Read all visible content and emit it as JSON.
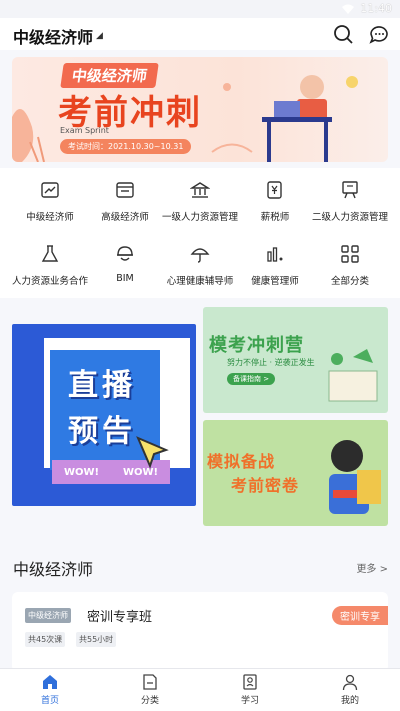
{
  "status": {
    "time": "11:40"
  },
  "header": {
    "title": "中级经济师"
  },
  "banner": {
    "tag": "中级经济师",
    "headline": "考前冲刺",
    "subtitle_en": "Exam Sprint",
    "exam_date": "考试时间：2021.10.30~10.31"
  },
  "categories": [
    {
      "label": "中级经济师",
      "icon": "chart-icon"
    },
    {
      "label": "高级经济师",
      "icon": "window-icon"
    },
    {
      "label": "一级人力资源管理",
      "icon": "bank-icon"
    },
    {
      "label": "薪税师",
      "icon": "yen-doc-icon"
    },
    {
      "label": "二级人力资源管理",
      "icon": "easel-icon"
    },
    {
      "label": "人力资源业务合作",
      "icon": "flask-icon"
    },
    {
      "label": "BIM",
      "icon": "helmet-icon"
    },
    {
      "label": "心理健康辅导师",
      "icon": "umbrella-icon"
    },
    {
      "label": "健康管理师",
      "icon": "bars-icon"
    },
    {
      "label": "全部分类",
      "icon": "grid-icon"
    }
  ],
  "promos": {
    "live": {
      "line1": "直播",
      "line2": "预告",
      "wow1": "WOW!",
      "wow2": "WOW!"
    },
    "camp": {
      "title": "模考冲刺营",
      "sub": "努力不停止 · 逆袭正发生",
      "btn": "备课指南 >"
    },
    "mock": {
      "line1": "模拟备战",
      "line2": "考前密卷"
    }
  },
  "section": {
    "title": "中级经济师",
    "more": "更多 >"
  },
  "course": {
    "tag": "中级经济师",
    "name": "密训专享班",
    "badge": "密训专享",
    "lessons": "共45次课",
    "hours": "共55小时"
  },
  "tabs": [
    {
      "label": "首页",
      "active": true
    },
    {
      "label": "分类",
      "active": false
    },
    {
      "label": "学习",
      "active": false
    },
    {
      "label": "我的",
      "active": false
    }
  ],
  "colors": {
    "accent": "#2f6fdb",
    "banner_red": "#e8441f",
    "live_blue": "#2c5ad6",
    "camp_green": "#3ca24e",
    "mock_orange": "#f0702a"
  }
}
